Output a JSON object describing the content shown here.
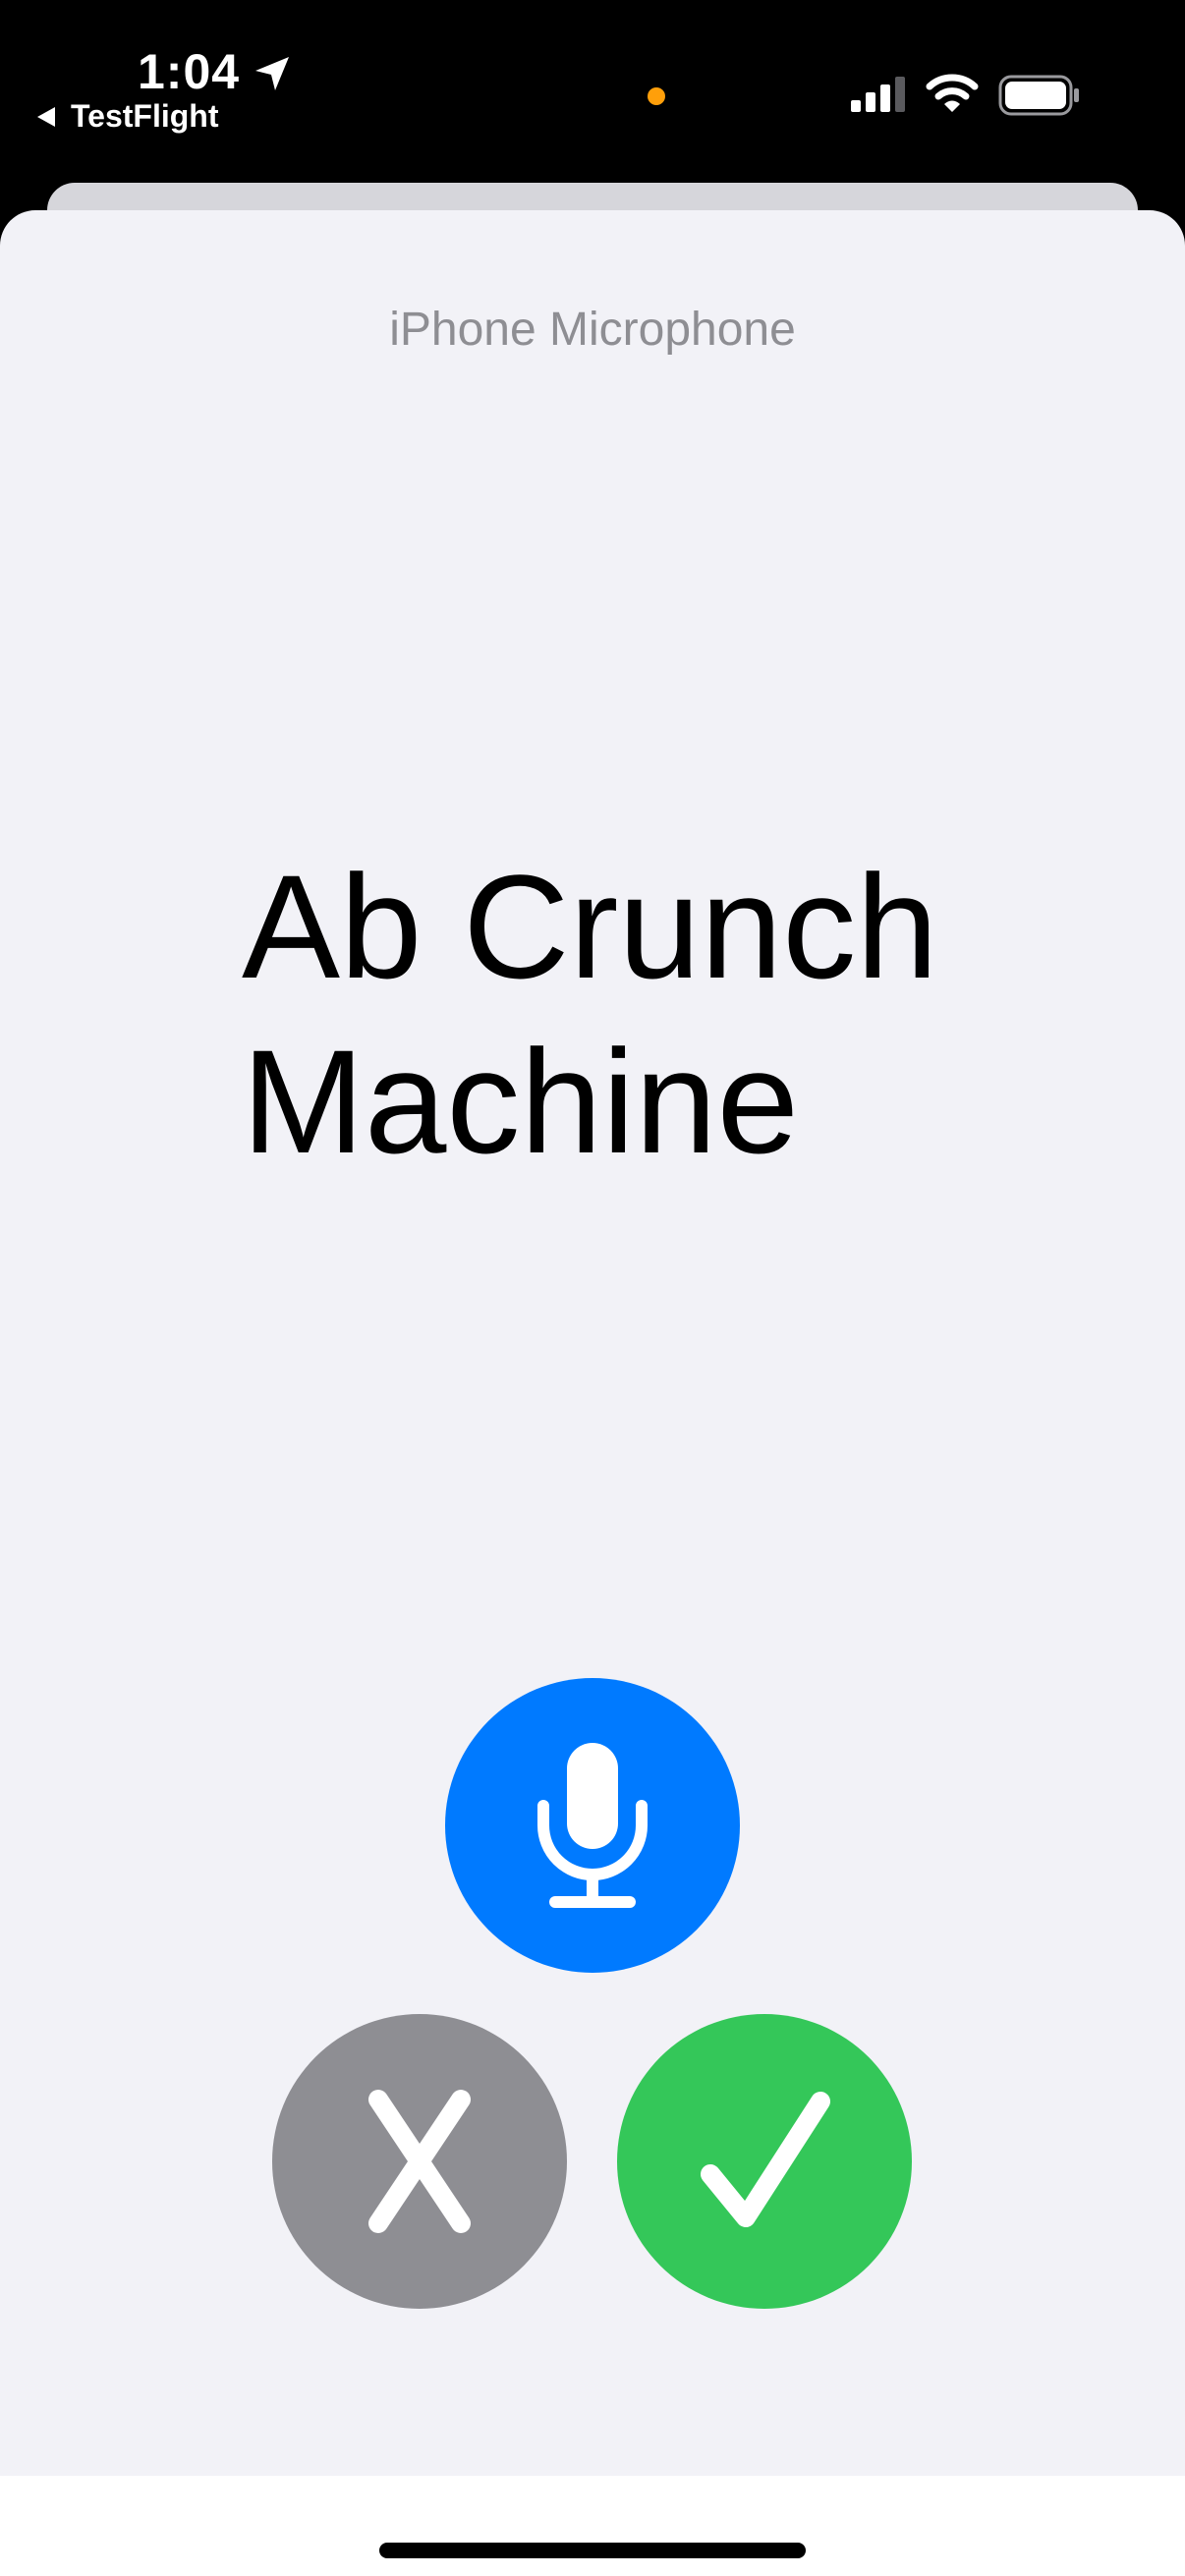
{
  "status_bar": {
    "time": "1:04",
    "back_label": "TestFlight",
    "icons": [
      "location-arrow-icon",
      "cellular-signal-icon",
      "wifi-icon",
      "battery-icon"
    ],
    "privacy_indicator_color": "#ff9f0a"
  },
  "sheet": {
    "title": "iPhone Microphone",
    "exercise_name": "Ab Crunch Machine"
  },
  "buttons": {
    "microphone": {
      "icon": "microphone-icon",
      "color": "#007aff"
    },
    "cancel": {
      "icon": "x-mark-icon",
      "color": "#8e8e93"
    },
    "confirm": {
      "icon": "checkmark-icon",
      "color": "#34c759"
    }
  }
}
